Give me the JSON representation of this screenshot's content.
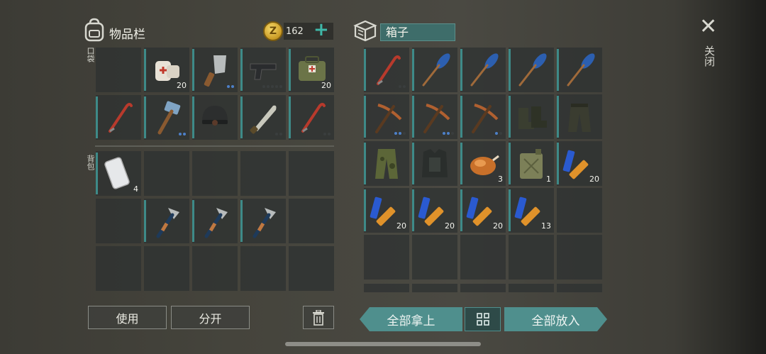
{
  "inventory": {
    "title": "物品栏",
    "pocket_label": "口袋",
    "backpack_label": "背包",
    "coins": "162",
    "coin_symbol": "Z",
    "plus": "+"
  },
  "container": {
    "title": "箱子"
  },
  "buttons": {
    "use": "使用",
    "split": "分开",
    "take_all": "全部拿上",
    "put_all": "全部放入",
    "close": "关闭",
    "close_glyph": "✕"
  },
  "pocket_slots": [
    {
      "item": "empty"
    },
    {
      "item": "bandage-icon",
      "qty": "20"
    },
    {
      "item": "cleaver-icon",
      "dots": 2,
      "dots_on": 2
    },
    {
      "item": "pistol-icon",
      "dots": 5,
      "dots_on": 0
    },
    {
      "item": "medkit-bag-icon",
      "qty": "20"
    },
    {
      "item": "crowbar-icon"
    },
    {
      "item": "sledgehammer-icon",
      "dots": 2,
      "dots_on": 2
    },
    {
      "item": "helmet-icon"
    },
    {
      "item": "machete-icon",
      "dots": 2,
      "dots_on": 0
    },
    {
      "item": "crowbar-icon",
      "dots": 2,
      "dots_on": 0
    }
  ],
  "backpack_slots": [
    {
      "item": "phone-icon",
      "qty": "4"
    },
    {
      "item": "empty"
    },
    {
      "item": "empty"
    },
    {
      "item": "empty"
    },
    {
      "item": "empty"
    },
    {
      "item": "empty"
    },
    {
      "item": "hatchet-icon"
    },
    {
      "item": "hatchet-icon"
    },
    {
      "item": "hatchet-icon"
    },
    {
      "item": "empty"
    },
    {
      "item": "empty"
    },
    {
      "item": "empty"
    },
    {
      "item": "empty"
    },
    {
      "item": "empty"
    },
    {
      "item": "empty"
    }
  ],
  "box_slots": [
    {
      "item": "crowbar-icon",
      "dots": 2,
      "dots_on": 0
    },
    {
      "item": "paddle-icon"
    },
    {
      "item": "paddle-icon"
    },
    {
      "item": "paddle-icon"
    },
    {
      "item": "paddle-icon"
    },
    {
      "item": "pickaxe-icon",
      "dots": 3,
      "dots_on": 2
    },
    {
      "item": "pickaxe-icon",
      "dots": 3,
      "dots_on": 2
    },
    {
      "item": "pickaxe-icon",
      "dots": 2,
      "dots_on": 1
    },
    {
      "item": "boots-icon"
    },
    {
      "item": "pants-icon"
    },
    {
      "item": "camo-pants-icon"
    },
    {
      "item": "armor-vest-icon"
    },
    {
      "item": "roast-chicken-icon",
      "qty": "3"
    },
    {
      "item": "jerrycan-icon",
      "qty": "1"
    },
    {
      "item": "batteries-icon",
      "qty": "20"
    },
    {
      "item": "batteries-icon",
      "qty": "20"
    },
    {
      "item": "batteries-icon",
      "qty": "20"
    },
    {
      "item": "batteries-icon",
      "qty": "20"
    },
    {
      "item": "batteries-icon",
      "qty": "13"
    },
    {
      "item": "empty"
    },
    {
      "item": "empty"
    },
    {
      "item": "empty"
    },
    {
      "item": "empty"
    },
    {
      "item": "empty"
    },
    {
      "item": "empty"
    }
  ],
  "colors": {
    "accent_teal": "#4f8f8d",
    "slot_bg": "#2c3030",
    "durability_bar": "#3e8a88",
    "dot_blue": "#4d80c8"
  }
}
